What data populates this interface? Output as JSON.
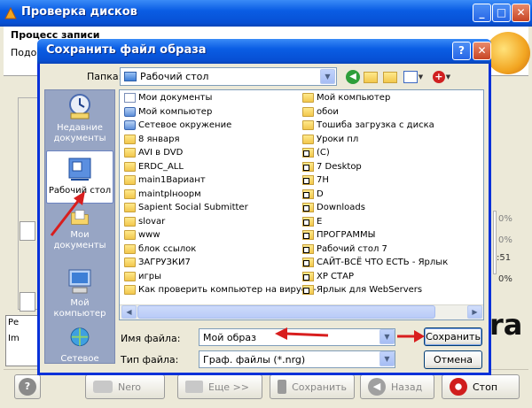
{
  "background_window": {
    "title": "Проверка дисков",
    "section_title": "Процесс записи",
    "section_sub": "Подож",
    "right_labels": [
      "0%",
      "0%",
      ":51",
      "0%"
    ],
    "left_labels": [
      "Ре",
      "Im"
    ],
    "brand": "ra",
    "buttons": [
      {
        "label": "Nero",
        "enabled": false
      },
      {
        "label": "Еще >>",
        "enabled": false
      },
      {
        "label": "Сохранить",
        "enabled": false
      },
      {
        "label": "Назад",
        "enabled": false
      },
      {
        "label": "Стоп",
        "enabled": true
      }
    ]
  },
  "dialog": {
    "title": "Сохранить файл образа",
    "help_glyph": "?",
    "close_glyph": "✕",
    "folder_label": "Папка:",
    "folder_value": "Рабочий стол",
    "places": [
      {
        "label": "Недавние документы",
        "icon": "recent-docs-icon",
        "selected": false
      },
      {
        "label": "Рабочий стол",
        "icon": "desktop-icon",
        "selected": true
      },
      {
        "label": "Мои документы",
        "icon": "my-documents-icon",
        "selected": false
      },
      {
        "label": "Мой компьютер",
        "icon": "my-computer-icon",
        "selected": false
      },
      {
        "label": "Сетевое",
        "icon": "network-icon",
        "selected": false
      }
    ],
    "files_col1": [
      {
        "name": "Мои документы",
        "icon": "doc"
      },
      {
        "name": "Мой компьютер",
        "icon": "sys"
      },
      {
        "name": "Сетевое окружение",
        "icon": "sys"
      },
      {
        "name": "8 января",
        "icon": "folder"
      },
      {
        "name": "AVI в DVD",
        "icon": "folder"
      },
      {
        "name": "ERDC_ALL",
        "icon": "folder"
      },
      {
        "name": "main1Вариант",
        "icon": "folder"
      },
      {
        "name": "maintplнoopм",
        "icon": "folder"
      },
      {
        "name": "Sapient Social Submitter",
        "icon": "folder"
      },
      {
        "name": "slovar",
        "icon": "folder"
      },
      {
        "name": "www",
        "icon": "folder"
      },
      {
        "name": "блок ссылок",
        "icon": "folder"
      },
      {
        "name": "ЗАГРУЗКИ7",
        "icon": "folder"
      },
      {
        "name": "игры",
        "icon": "folder"
      },
      {
        "name": "Как проверить компьютер на вирусы-",
        "icon": "folder"
      }
    ],
    "files_col2": [
      {
        "name": "Мой компьютер",
        "icon": "folder"
      },
      {
        "name": "обои",
        "icon": "folder"
      },
      {
        "name": "Тошиба загрузка с диска",
        "icon": "folder"
      },
      {
        "name": "Уроки пл",
        "icon": "folder"
      },
      {
        "name": "(C)",
        "icon": "lnk"
      },
      {
        "name": "7 Desktop",
        "icon": "lnk"
      },
      {
        "name": "7H",
        "icon": "lnk"
      },
      {
        "name": "D",
        "icon": "lnk"
      },
      {
        "name": "Downloads",
        "icon": "lnk"
      },
      {
        "name": "E",
        "icon": "lnk"
      },
      {
        "name": "ПРОГРАММЫ",
        "icon": "lnk"
      },
      {
        "name": "Рабочий стол 7",
        "icon": "lnk"
      },
      {
        "name": "САЙТ-ВСЁ ЧТО ЕСТЬ - Ярлык",
        "icon": "lnk"
      },
      {
        "name": "XP СТАР",
        "icon": "lnk"
      },
      {
        "name": "Ярлык для WebServers",
        "icon": "lnk"
      }
    ],
    "filename_label": "Имя файла:",
    "filename_value": "Мой образ",
    "filetype_label": "Тип файла:",
    "filetype_value": "Граф. файлы (*.nrg)",
    "save_button": "Сохранить",
    "cancel_button": "Отмена"
  },
  "colors": {
    "accent_red": "#D81E1E",
    "xp_blue": "#0A5DE4"
  }
}
